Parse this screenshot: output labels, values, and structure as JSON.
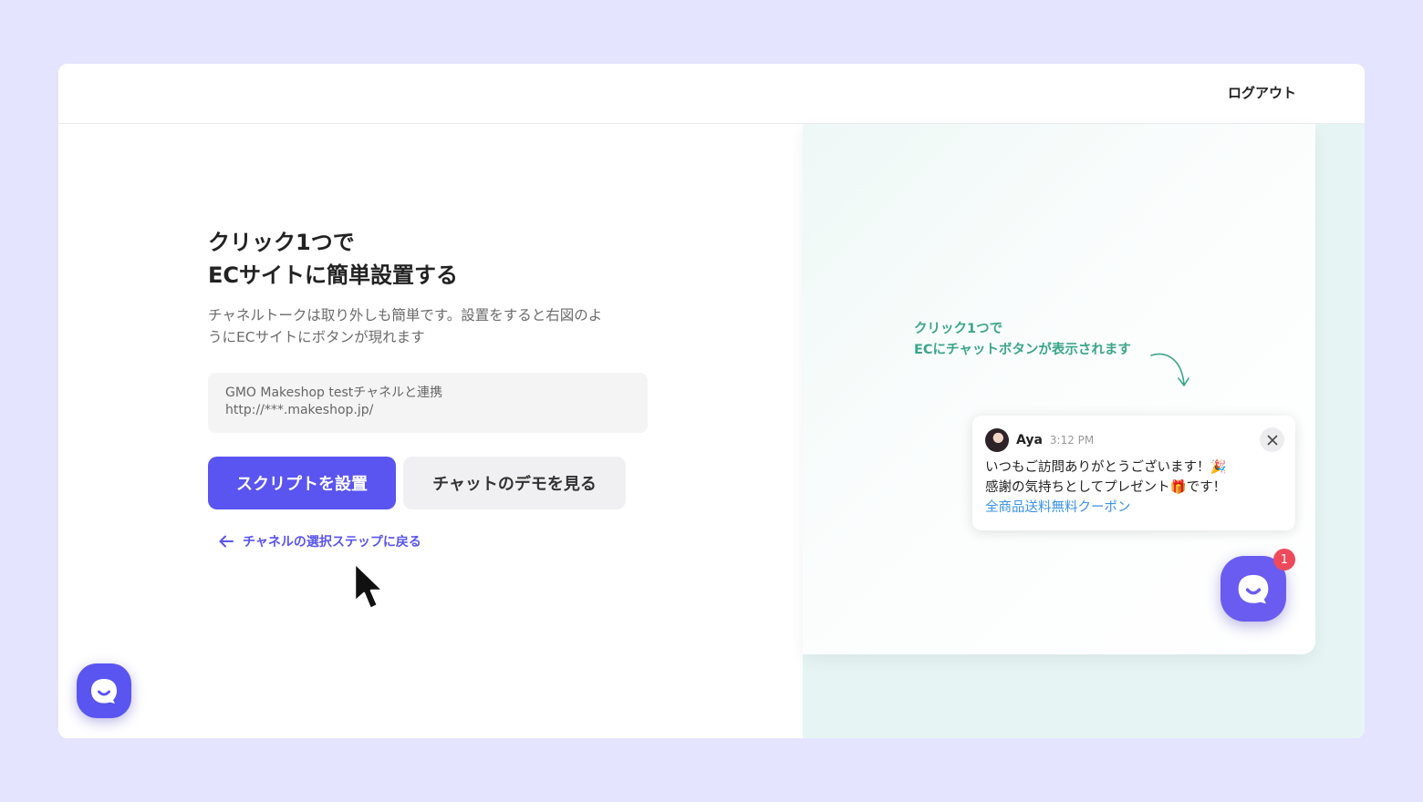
{
  "header": {
    "logout_label": "ログアウト"
  },
  "setup": {
    "title_line1": "クリック1つで",
    "title_line2": "ECサイトに簡単設置する",
    "desc_line1": "チャネルトークは取り外しも簡単です。設置をすると右図のよ",
    "desc_line2": "うにECサイトにボタンが現れます",
    "channel_name": "GMO Makeshop testチャネルと連携",
    "channel_url": "http://***.makeshop.jp/",
    "install_button": "スクリプトを設置",
    "demo_button": "チャットのデモを見る",
    "back_link": "チャネルの選択ステップに戻る"
  },
  "preview": {
    "annot_line1": "クリック1つで",
    "annot_line2": "ECにチャットボタンが表示されます",
    "popup_name": "Aya",
    "popup_time": "3:12 PM",
    "msg_line1": "いつもご訪問ありがとうございます！🎉",
    "msg_line2": "感謝の気持ちとしてプレゼント🎁です！",
    "msg_link": "全商品送料無料クーポン",
    "badge_count": "1"
  },
  "colors": {
    "accent": "#5a54f0",
    "annotation": "#3aa58a",
    "link": "#3a92e6",
    "badge": "#ee4a5b",
    "background": "#e4e4ff"
  }
}
